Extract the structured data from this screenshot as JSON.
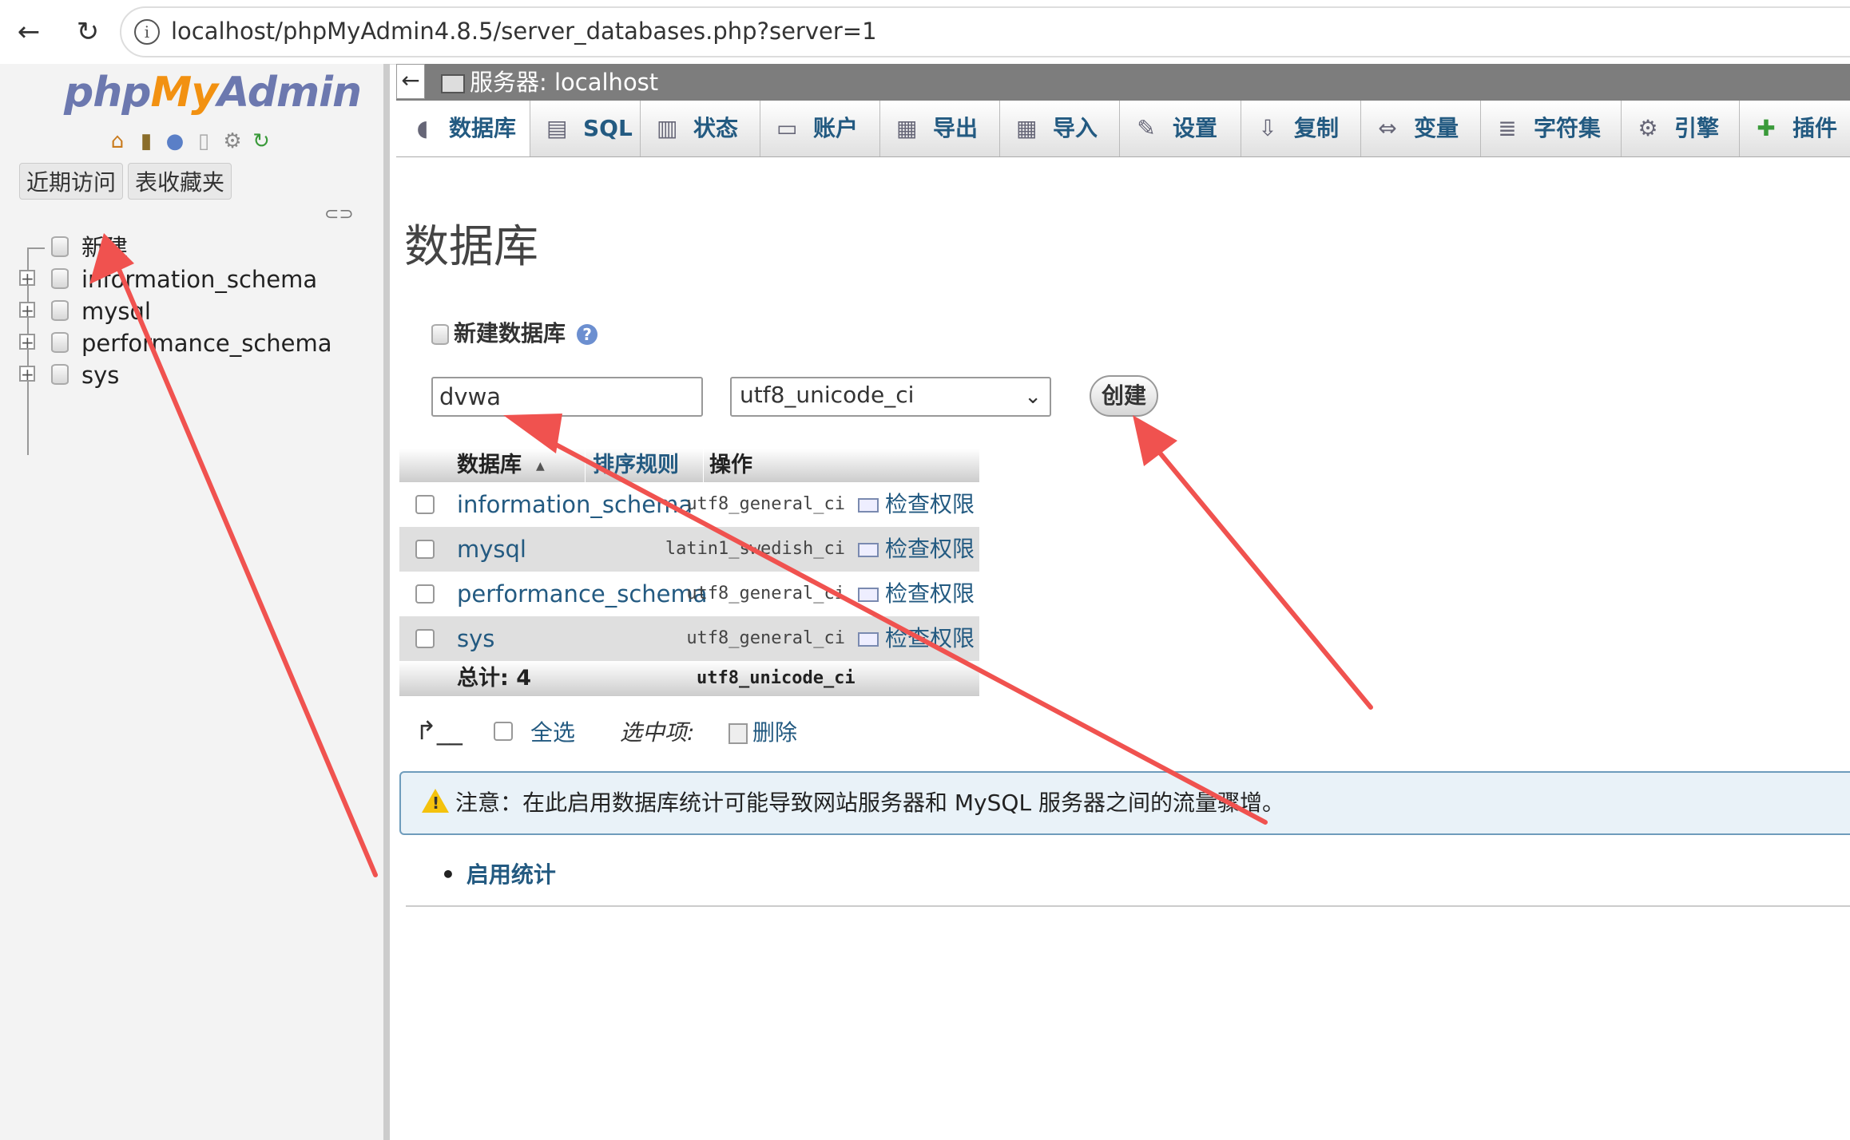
{
  "browser": {
    "url": "localhost/phpMyAdmin4.8.5/server_databases.php?server=1"
  },
  "nav": {
    "logo": {
      "php": "php",
      "my": "My",
      "admin": "Admin"
    },
    "tabs": [
      "近期访问",
      "表收藏夹"
    ],
    "tree": [
      {
        "label": "新建"
      },
      {
        "label": "information_schema"
      },
      {
        "label": "mysql"
      },
      {
        "label": "performance_schema"
      },
      {
        "label": "sys"
      }
    ]
  },
  "server_bar": {
    "title": "服务器: localhost"
  },
  "tabs": [
    {
      "label": "数据库",
      "icon": "database-icon"
    },
    {
      "label": "SQL",
      "icon": "sql-icon"
    },
    {
      "label": "状态",
      "icon": "status-icon"
    },
    {
      "label": "账户",
      "icon": "accounts-icon"
    },
    {
      "label": "导出",
      "icon": "export-icon"
    },
    {
      "label": "导入",
      "icon": "import-icon"
    },
    {
      "label": "设置",
      "icon": "wrench-icon"
    },
    {
      "label": "复制",
      "icon": "replication-icon"
    },
    {
      "label": "变量",
      "icon": "variables-icon"
    },
    {
      "label": "字符集",
      "icon": "charset-icon"
    },
    {
      "label": "引擎",
      "icon": "engine-icon"
    },
    {
      "label": "插件",
      "icon": "plugin-icon"
    }
  ],
  "main": {
    "page_title": "数据库",
    "create_heading": "新建数据库",
    "dbname_value": "dvwa",
    "collation_selected": "utf8_unicode_ci",
    "create_label": "创建",
    "table": {
      "headers": {
        "database": "数据库",
        "collation": "排序规则",
        "action": "操作"
      },
      "rows": [
        {
          "name": "information_schema",
          "collation": "utf8_general_ci",
          "action": "检查权限"
        },
        {
          "name": "mysql",
          "collation": "latin1_swedish_ci",
          "action": "检查权限"
        },
        {
          "name": "performance_schema",
          "collation": "utf8_general_ci",
          "action": "检查权限"
        },
        {
          "name": "sys",
          "collation": "utf8_general_ci",
          "action": "检查权限"
        }
      ],
      "total_label": "总计: 4",
      "total_collation": "utf8_unicode_ci"
    },
    "bulk": {
      "select_all": "全选",
      "with_selected": "选中项:",
      "delete": "删除"
    },
    "notice": "注意：在此启用数据库统计可能导致网站服务器和 MySQL 服务器之间的流量骤增。",
    "enable_stats": "启用统计"
  },
  "colors": {
    "link": "#235a81",
    "annotation": "#f0524f",
    "server_bar": "#7d7d7d"
  }
}
